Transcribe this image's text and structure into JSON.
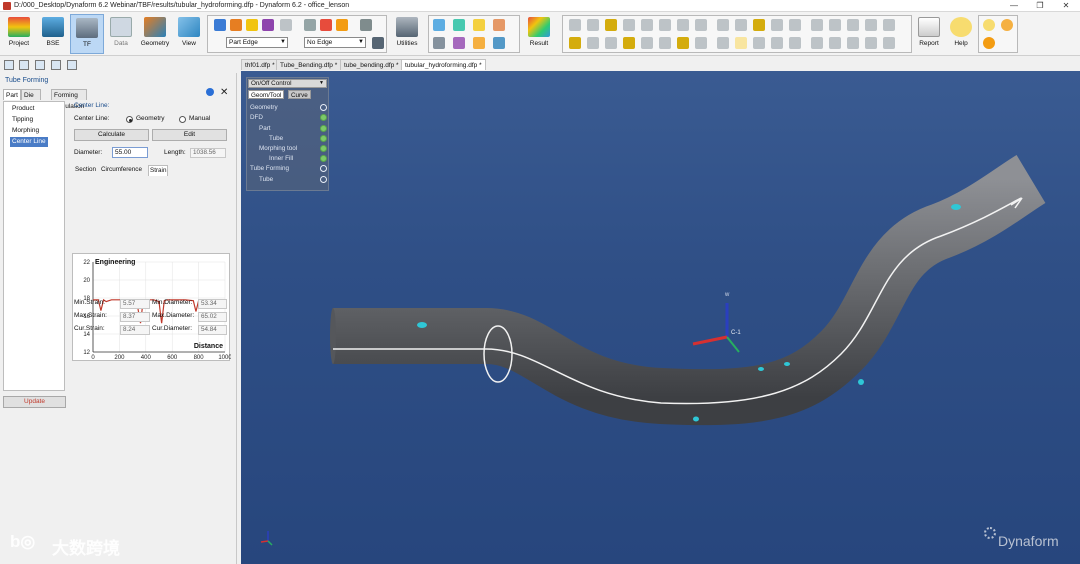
{
  "window": {
    "title": "D:/000_Desktop/Dynaform 6.2 Webinar/TBF/results/tubular_hydroforming.dfp - Dynaform 6.2 - office_lenson",
    "minimize": "—",
    "maximize": "❐",
    "close": "✕"
  },
  "toolbar": {
    "big_buttons": [
      "Project",
      "BSE",
      "TF",
      "Data",
      "Geometry",
      "View"
    ],
    "part_combo": "Part Edge",
    "edge_combo": "No Edge",
    "utilities": "Utilities",
    "result": "Result",
    "report": "Report",
    "help": "Help"
  },
  "panel": {
    "title": "Tube Forming",
    "tabs": [
      "Part",
      "Die Face",
      "Forming Simulation"
    ],
    "tree": [
      "Product",
      "Tipping",
      "Morphing",
      "Center Line"
    ],
    "selected_tree": "Center Line",
    "section_header": "Center Line:",
    "centerline_label": "Center Line:",
    "radio_geometry": "Geometry",
    "radio_manual": "Manual",
    "calculate": "Calculate",
    "edit": "Edit",
    "diameter_label": "Diameter:",
    "diameter_value": "55.00",
    "length_label": "Length:",
    "length_value": "1038.56",
    "subtabs": [
      "Section",
      "Circumference",
      "Strain"
    ],
    "min_strain_label": "Min.Strain:",
    "min_strain": "5.57",
    "max_strain_label": "Max.Strain:",
    "max_strain": "8.37",
    "cur_strain_label": "Cur.Strain:",
    "cur_strain": "8.24",
    "min_diam_label": "Min.Diameter:",
    "min_diam": "53.34",
    "max_diam_label": "Max.Diameter:",
    "max_diam": "65.02",
    "cur_diam_label": "Cur.Diameter:",
    "cur_diam": "54.84",
    "update": "Update"
  },
  "chart_data": {
    "type": "line",
    "title": "Engineering",
    "xlabel": "Distance",
    "ylabel": "",
    "xlim": [
      0,
      1000
    ],
    "ylim": [
      12,
      22
    ],
    "xticks": [
      "0",
      "200",
      "400",
      "600",
      "800",
      "1000"
    ],
    "yticks": [
      "12",
      "14",
      "16",
      "18",
      "20",
      "22"
    ],
    "grid": true,
    "series": [
      {
        "x": [
          0,
          40,
          60,
          80,
          100,
          140,
          200,
          280,
          330,
          360,
          380,
          400,
          420,
          460,
          500,
          520,
          540,
          560,
          600,
          700,
          760,
          780,
          800,
          840,
          900,
          1000
        ],
        "y": [
          17.8,
          17.8,
          16.6,
          17.8,
          17.6,
          17.8,
          17.8,
          17.8,
          17.7,
          15.2,
          17.7,
          17.8,
          17.8,
          17.8,
          17.6,
          15.2,
          17.7,
          17.8,
          17.8,
          17.8,
          17.7,
          16.5,
          17.7,
          17.8,
          17.8,
          17.8
        ]
      }
    ]
  },
  "file_tabs": [
    "thf01.dfp *",
    "Tube_Bending.dfp *",
    "tube_bending.dfp *",
    "tubular_hydroforming.dfp *"
  ],
  "onoff": {
    "header": "On/Off Control",
    "subtabs": [
      "Geom/Tool",
      "Curve"
    ],
    "items": [
      {
        "label": "Geometry",
        "on": false
      },
      {
        "label": "DFD",
        "on": true
      },
      {
        "label": "Part",
        "on": true
      },
      {
        "label": "Tube",
        "on": true
      },
      {
        "label": "Morphing tool",
        "on": true
      },
      {
        "label": "Inner Fill",
        "on": true
      },
      {
        "label": "Tube Forming",
        "on": false
      },
      {
        "label": "Tube",
        "on": false
      }
    ]
  },
  "axes_labels": {
    "w": "w",
    "c": "C-1"
  },
  "watermark": "大数跨境",
  "brand": "Dynaform",
  "colors": {
    "accent": "#bcd8f5",
    "tube": "#6d6f73",
    "marker": "#2fc7d6",
    "curve": "#c0392b"
  }
}
